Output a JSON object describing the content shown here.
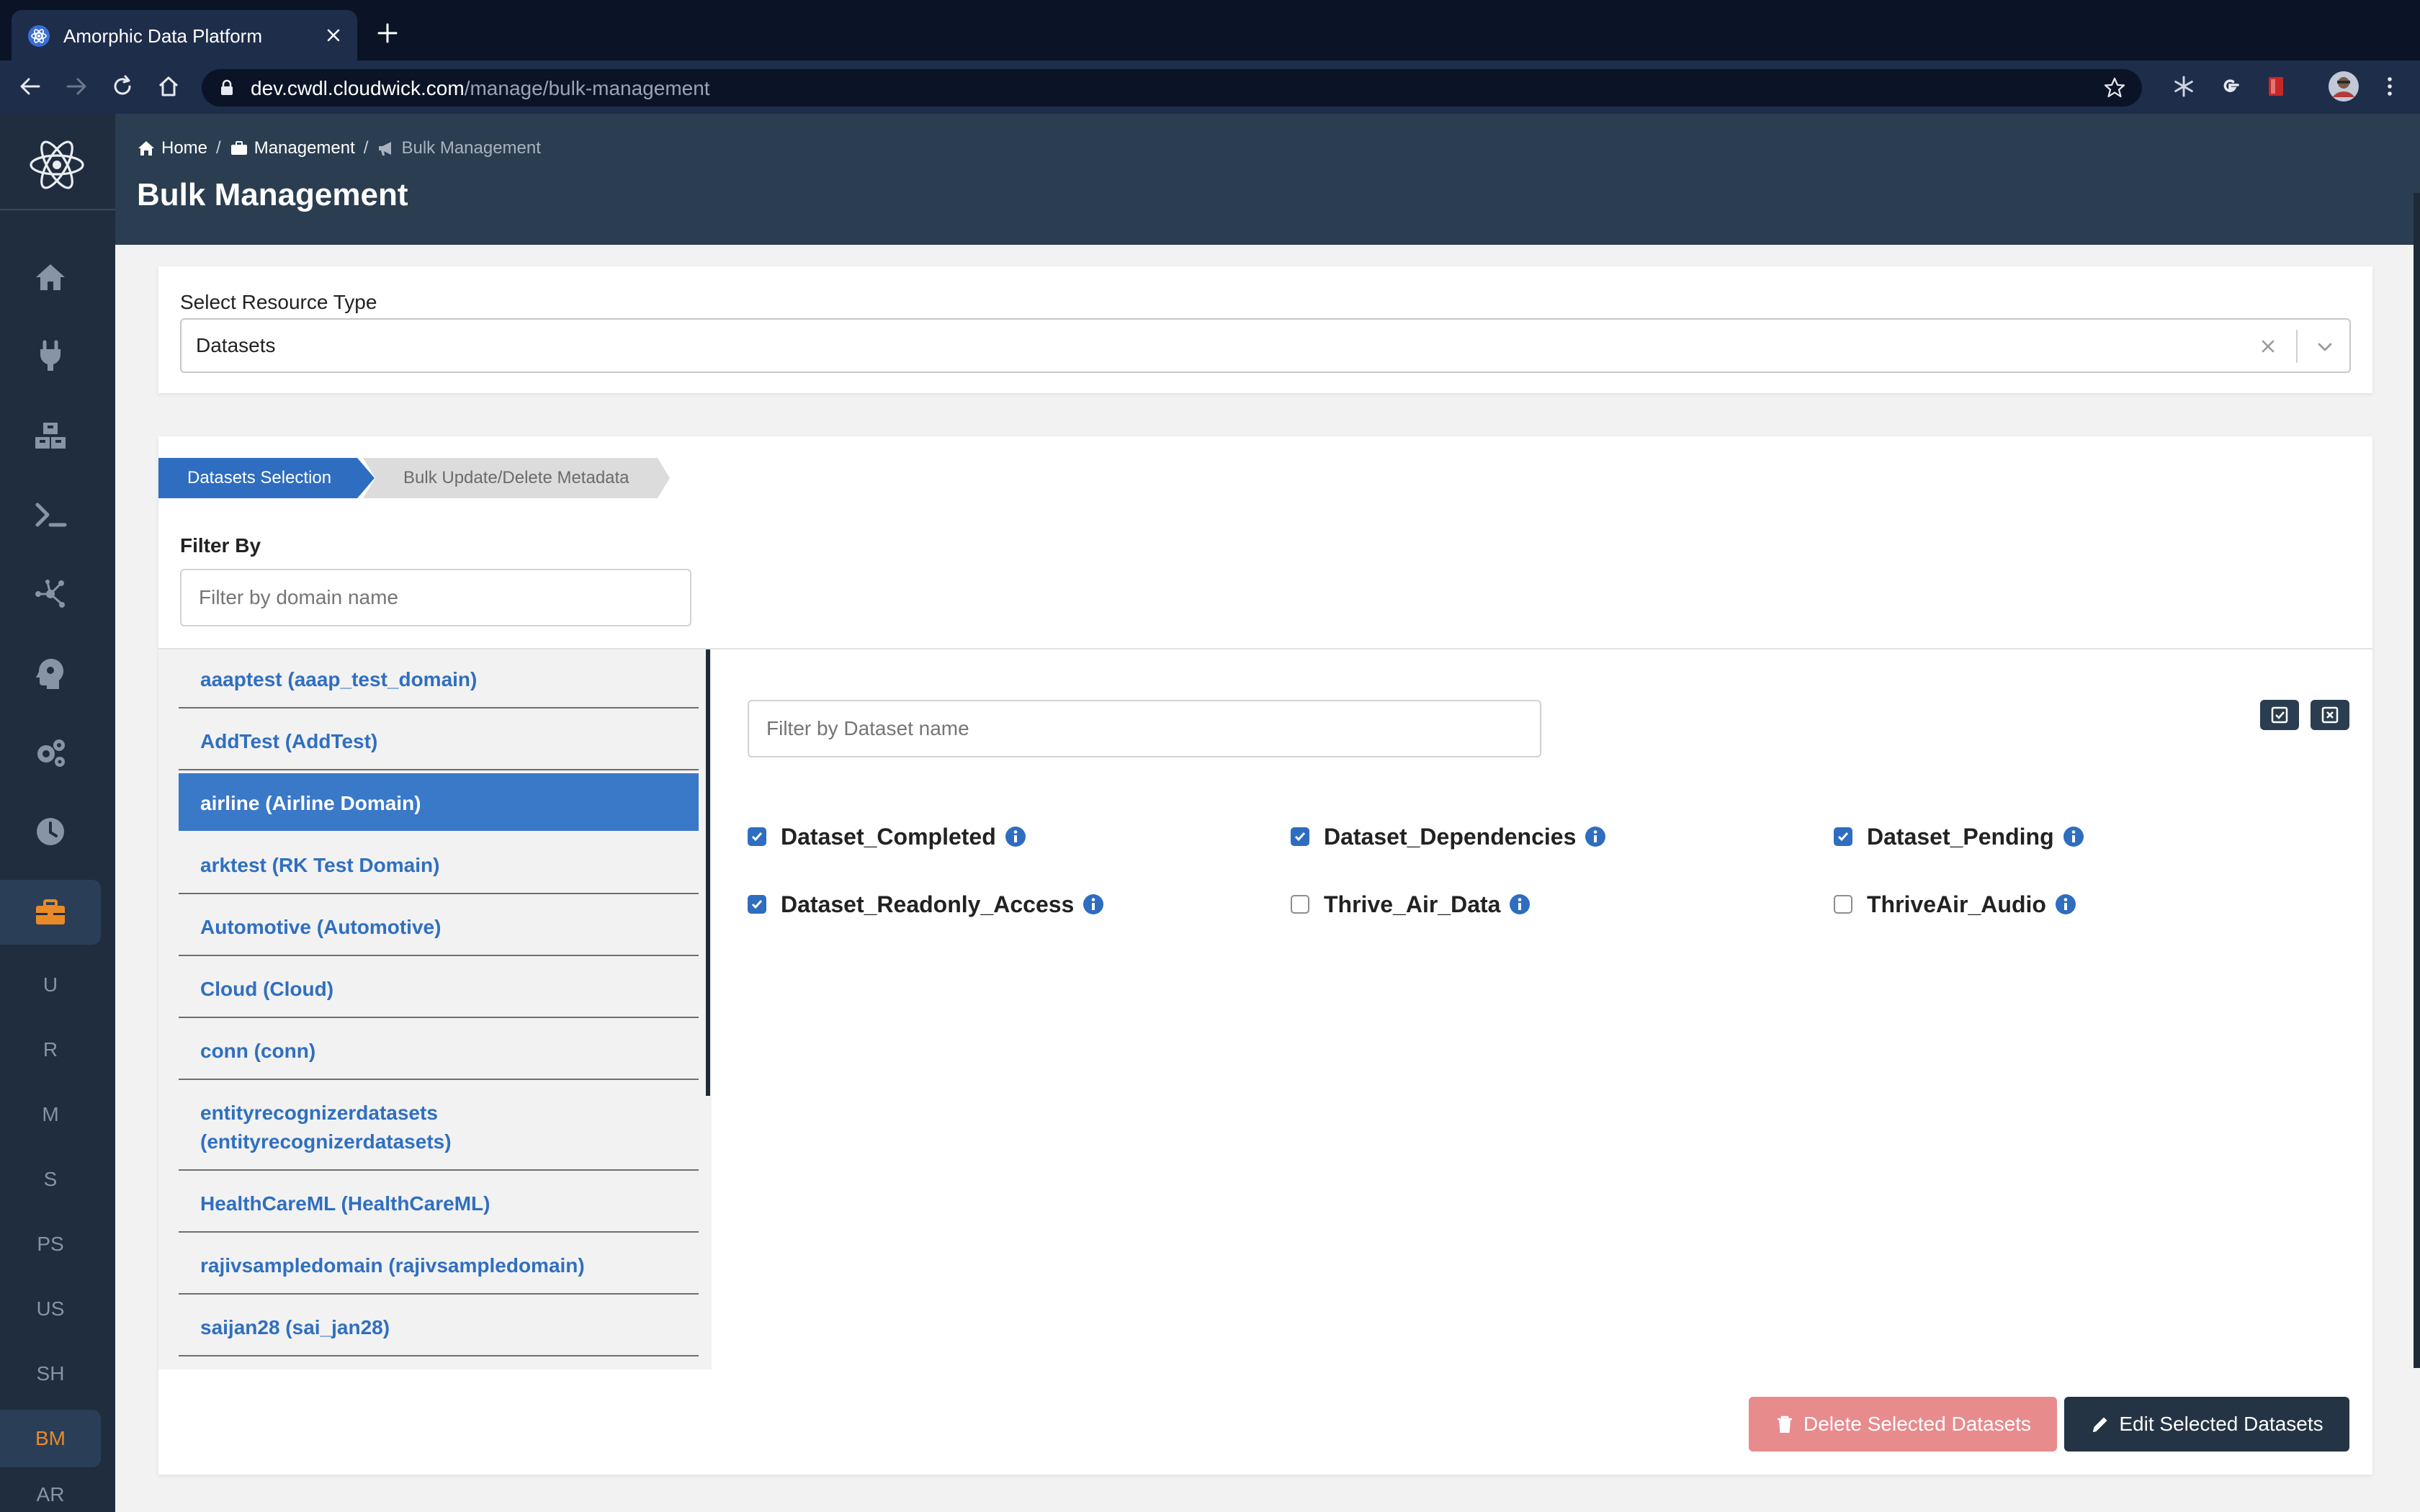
{
  "browser": {
    "tab_title": "Amorphic Data Platform",
    "url_host": "dev.cwdl.cloudwick.com",
    "url_path": "/manage/bulk-management"
  },
  "sidebar": {
    "text_items": [
      "U",
      "R",
      "M",
      "S",
      "PS",
      "US",
      "SH",
      "BM",
      "AR"
    ],
    "active_text_item": "BM",
    "active_color": "#e98a26"
  },
  "header": {
    "breadcrumb": {
      "home": "Home",
      "management": "Management",
      "current": "Bulk Management"
    },
    "title": "Bulk Management"
  },
  "resource": {
    "label": "Select Resource Type",
    "value": "Datasets"
  },
  "steps": {
    "step1": "Datasets Selection",
    "step2": "Bulk Update/Delete Metadata"
  },
  "filter": {
    "title": "Filter By",
    "domain_placeholder": "Filter by domain name",
    "dataset_placeholder": "Filter by Dataset name"
  },
  "domains": [
    {
      "label": "aaaptest (aaap_test_domain)"
    },
    {
      "label": "AddTest (AddTest)"
    },
    {
      "label": "airline (Airline Domain)"
    },
    {
      "label": "arktest (RK Test Domain)"
    },
    {
      "label": "Automotive (Automotive)"
    },
    {
      "label": "Cloud (Cloud)"
    },
    {
      "label": "conn (conn)"
    },
    {
      "label": "entityrecognizerdatasets (entityrecognizerdatasets)"
    },
    {
      "label": "HealthCareML (HealthCareML)"
    },
    {
      "label": "rajivsampledomain (rajivsampledomain)"
    },
    {
      "label": "saijan28 (sai_jan28)"
    }
  ],
  "selected_domain": "airline (Airline Domain)",
  "datasets": [
    {
      "name": "Dataset_Completed",
      "checked": true
    },
    {
      "name": "Dataset_Dependencies",
      "checked": true
    },
    {
      "name": "Dataset_Pending",
      "checked": true
    },
    {
      "name": "Dataset_Readonly_Access",
      "checked": true
    },
    {
      "name": "Thrive_Air_Data",
      "checked": false
    },
    {
      "name": "ThriveAir_Audio",
      "checked": false
    }
  ],
  "actions": {
    "delete": "Delete Selected Datasets",
    "edit": "Edit Selected Datasets"
  },
  "colors": {
    "primary": "#2e6dbf",
    "header_bg": "#2b3d50",
    "sidebar_bg": "#1f2d3e",
    "delete_btn": "#e88b8d",
    "edit_btn": "#243444"
  }
}
